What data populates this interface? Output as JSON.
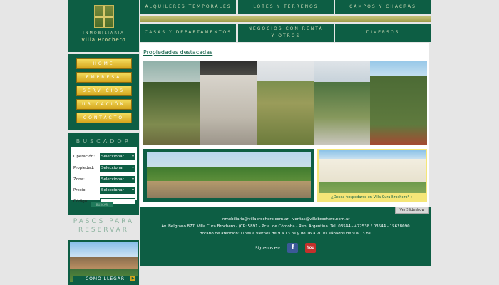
{
  "logo": {
    "line1": "INMOBILIARIA",
    "line2": "Villa Brochero"
  },
  "menu": [
    "HOME",
    "EMPRESA",
    "SERVICIOS",
    "UBICACIÓN",
    "CONTACTO"
  ],
  "top_nav": [
    "ALQUILERES TEMPORALES",
    "LOTES Y TERRENOS",
    "CAMPOS Y CHACRAS",
    "CASAS Y DEPARTAMENTOS",
    "NEGOCIOS CON RENTA Y OTROS",
    "DIVERSOS"
  ],
  "buscador": {
    "title": "BUSCADOR",
    "fields": [
      {
        "label": "Operación:",
        "value": "Seleccionar"
      },
      {
        "label": "Propiedad:",
        "value": "Seleccionar"
      },
      {
        "label": "Zona:",
        "value": "Seleccionar"
      },
      {
        "label": "Precio:",
        "value": "Seleccionar"
      }
    ],
    "codigo_label": "Código:",
    "search_button": "BUSCAR"
  },
  "pasos": {
    "line1": "PASOS PARA",
    "line2": "RESERVAR"
  },
  "como_llegar": "COMO LLEGAR",
  "main": {
    "featured_title": "Propiedades destacadas",
    "hotel_caption": "¿Desea hospedarse en Villa Cura Brochero?",
    "ver_button": "Ver Slideshow"
  },
  "footer": {
    "emails": "inmobiliaria@villabrochero.com.ar  -  ventas@villabrochero.com.ar",
    "address": "Av. Belgrano 877, Villa Cura Brochero - (CP: 5891 - Pcia. de Córdoba - Rep. Argentina. Tel: 03544 - 472538 / 03544 - 15628090",
    "hours": "Horario de atención: lunes a viernes de 9 a 13 hs y de 16 a 20 hs sábados de 9 a 13 hs.",
    "follow": "Síguenos en:"
  },
  "colors": {
    "brand_green": "#0d5e44",
    "gold": "#d5a51d"
  }
}
